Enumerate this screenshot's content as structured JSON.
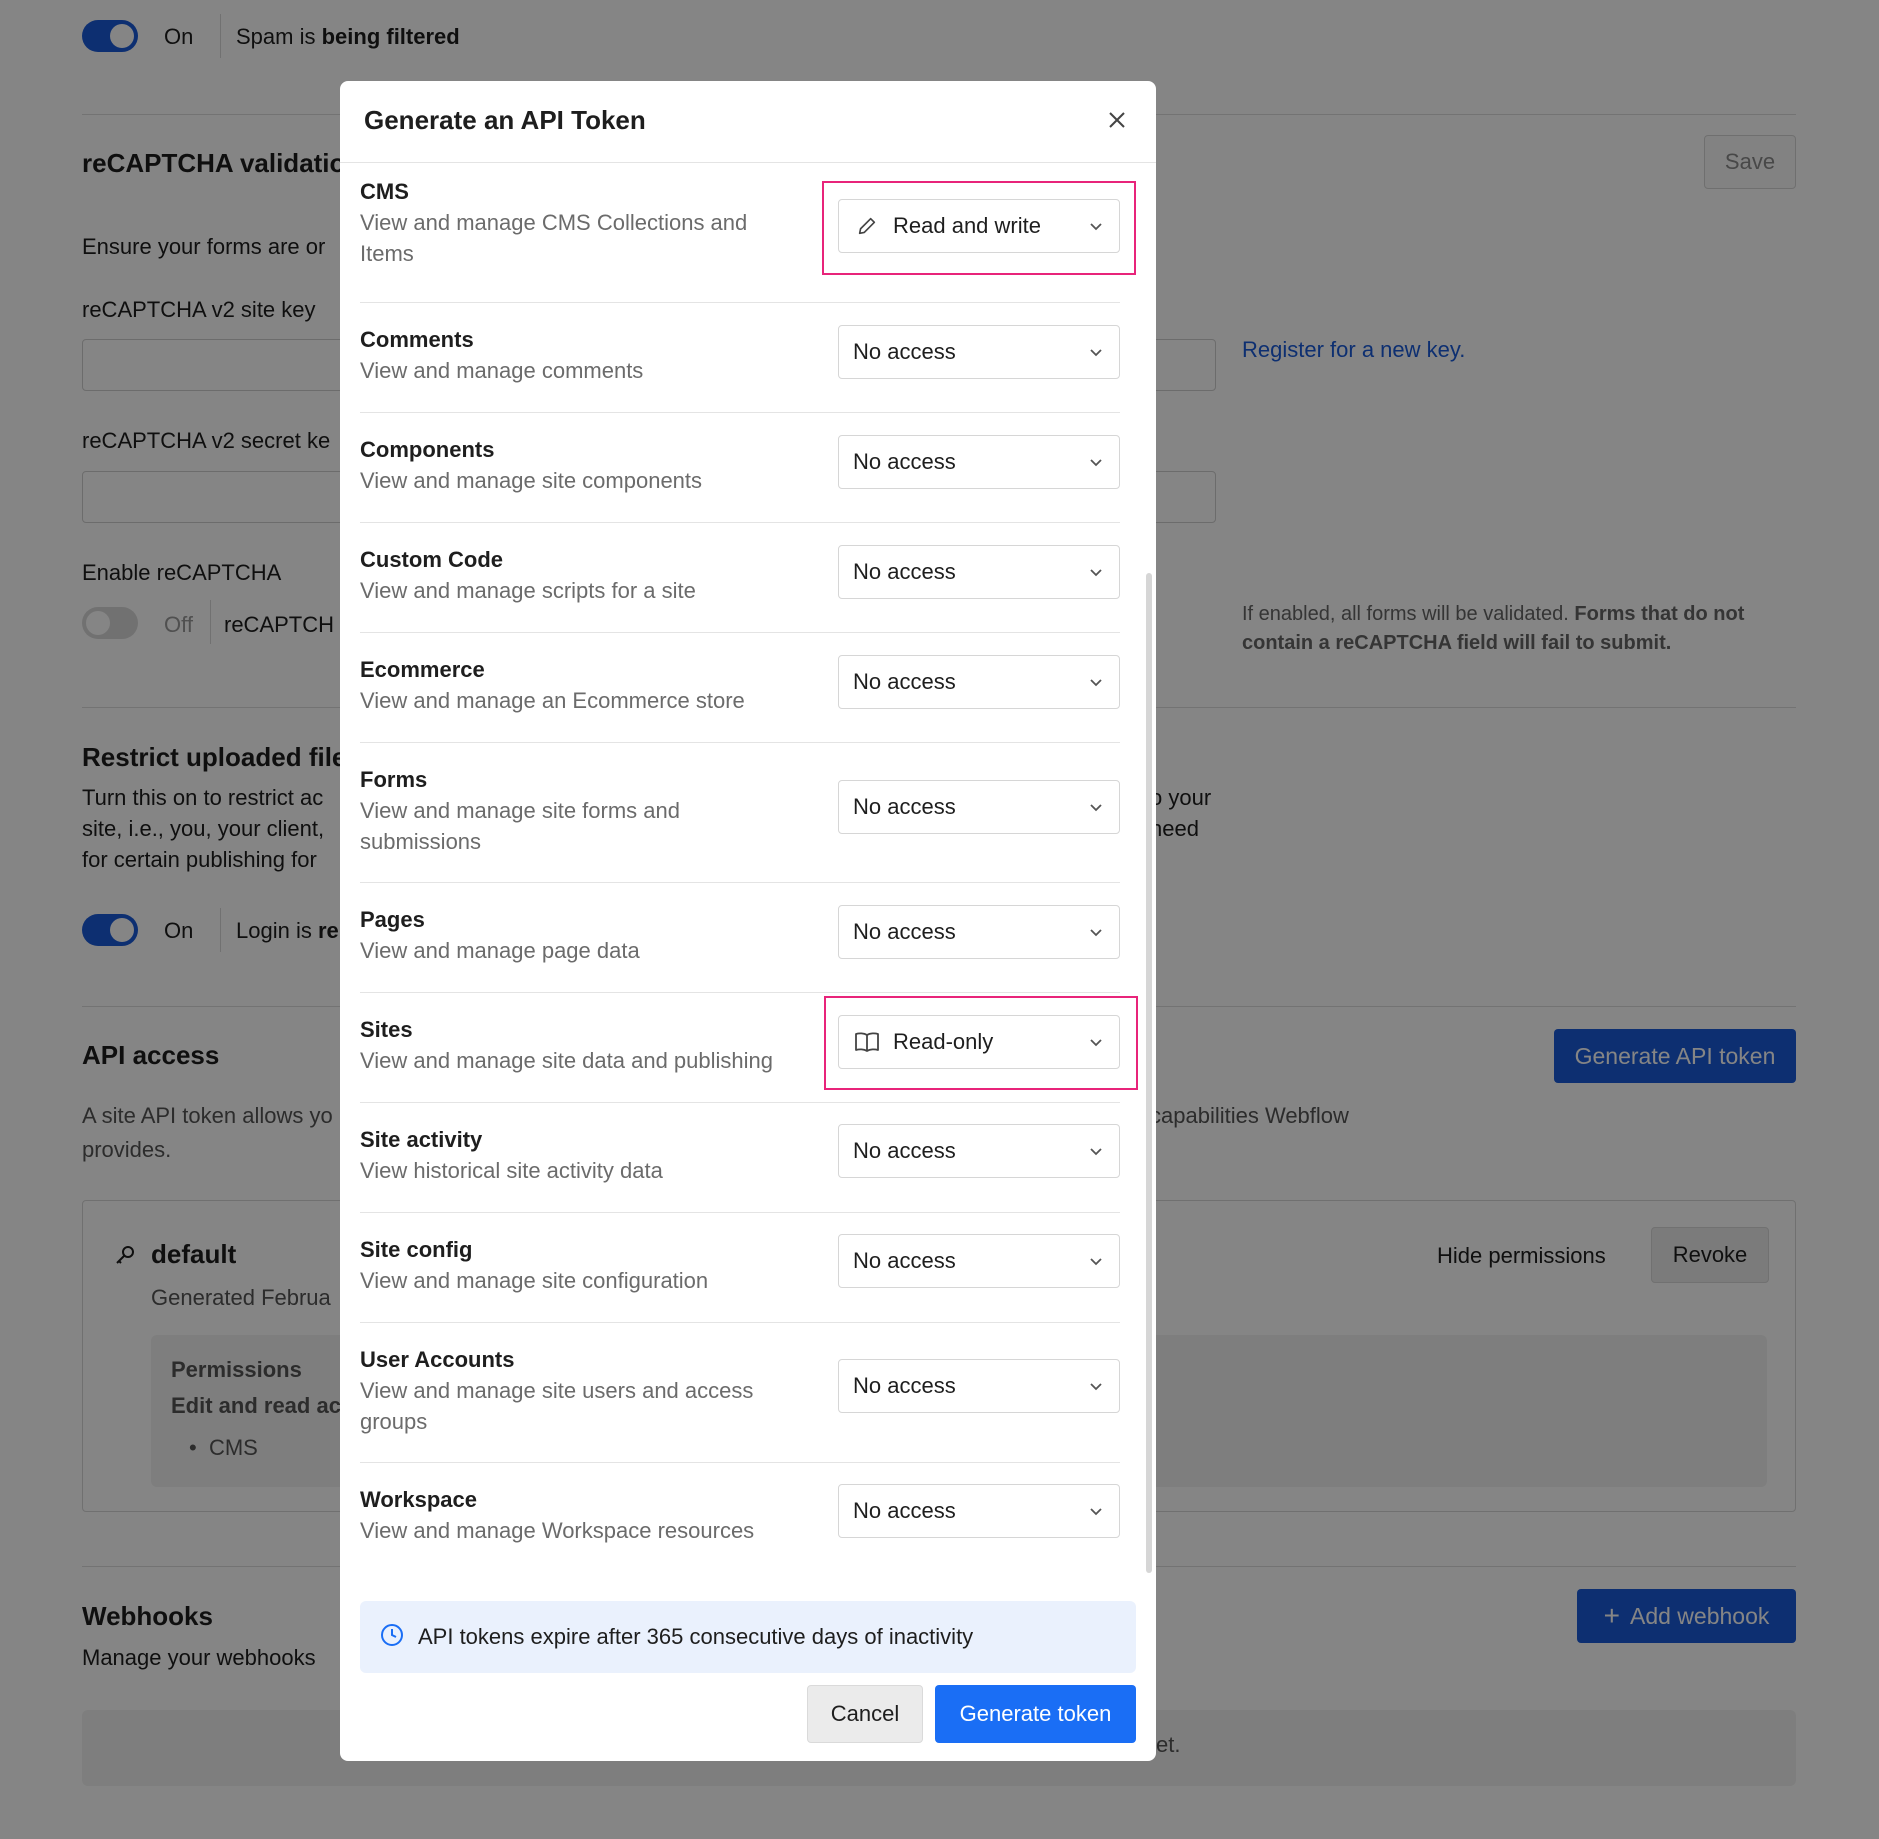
{
  "background": {
    "spam": {
      "toggle_label": "On",
      "status_prefix": "Spam is ",
      "status_bold": "being filtered"
    },
    "recaptcha": {
      "title": "reCAPTCHA validatio",
      "save_label": "Save",
      "description": "Ensure your forms are or",
      "site_key_label": "reCAPTCHA v2 site key",
      "register_link": "Register for a new key.",
      "secret_key_label": "reCAPTCHA v2 secret ke",
      "enable_label": "Enable reCAPTCHA",
      "toggle_label": "Off",
      "toggle_status": "reCAPTCH",
      "note_plain": "If enabled, all forms will be validated. ",
      "note_bold_1": "Forms that do not",
      "note_bold_2": "contain a reCAPTCHA field will fail to submit."
    },
    "restrict": {
      "title": "Restrict uploaded file",
      "desc_line1": "Turn this on to restrict ac",
      "desc_line2": "site, i.e., you, your client,",
      "desc_line3": "for certain publishing for",
      "desc_right1": "o your",
      "desc_right2": "need",
      "toggle_label": "On",
      "toggle_status_prefix": "Login is ",
      "toggle_status_bold": "re"
    },
    "api": {
      "title": "API access",
      "generate_label": "Generate API token",
      "desc_line1": "A site API token allows yo",
      "desc_right": "capabilities Webflow",
      "desc_line2": "provides.",
      "token_name": "default",
      "token_generated": "Generated Februa",
      "hide_permissions": "Hide permissions",
      "revoke": "Revoke",
      "permissions_title": "Permissions",
      "permissions_desc": "Edit and read ac",
      "permissions_item": "CMS"
    },
    "webhooks": {
      "title": "Webhooks",
      "add_label": "Add webhook",
      "desc": "Manage your webhooks",
      "empty_tail": "et."
    }
  },
  "modal": {
    "title": "Generate an API Token",
    "permissions": [
      {
        "name": "CMS",
        "desc": "View and manage CMS Collections and Items",
        "value": "Read and write",
        "icon": "pencil-icon"
      },
      {
        "name": "Comments",
        "desc": "View and manage comments",
        "value": "No access",
        "icon": ""
      },
      {
        "name": "Components",
        "desc": "View and manage site components",
        "value": "No access",
        "icon": ""
      },
      {
        "name": "Custom Code",
        "desc": "View and manage scripts for a site",
        "value": "No access",
        "icon": ""
      },
      {
        "name": "Ecommerce",
        "desc": "View and manage an Ecommerce store",
        "value": "No access",
        "icon": ""
      },
      {
        "name": "Forms",
        "desc": "View and manage site forms and submissions",
        "value": "No access",
        "icon": ""
      },
      {
        "name": "Pages",
        "desc": "View and manage page data",
        "value": "No access",
        "icon": ""
      },
      {
        "name": "Sites",
        "desc": "View and manage site data and publishing",
        "value": "Read-only",
        "icon": "book-icon"
      },
      {
        "name": "Site activity",
        "desc": "View historical site activity data",
        "value": "No access",
        "icon": ""
      },
      {
        "name": "Site config",
        "desc": "View and manage site configuration",
        "value": "No access",
        "icon": ""
      },
      {
        "name": "User Accounts",
        "desc": "View and manage site users and access groups",
        "value": "No access",
        "icon": ""
      },
      {
        "name": "Workspace",
        "desc": "View and manage Workspace resources",
        "value": "No access",
        "icon": ""
      }
    ],
    "notice": "API tokens expire after 365 consecutive days of inactivity",
    "cancel_label": "Cancel",
    "generate_label": "Generate token"
  },
  "colors": {
    "accent_blue": "#1a6ef5",
    "highlight_pink": "#e8247a",
    "notice_bg": "#eaf1fd"
  }
}
